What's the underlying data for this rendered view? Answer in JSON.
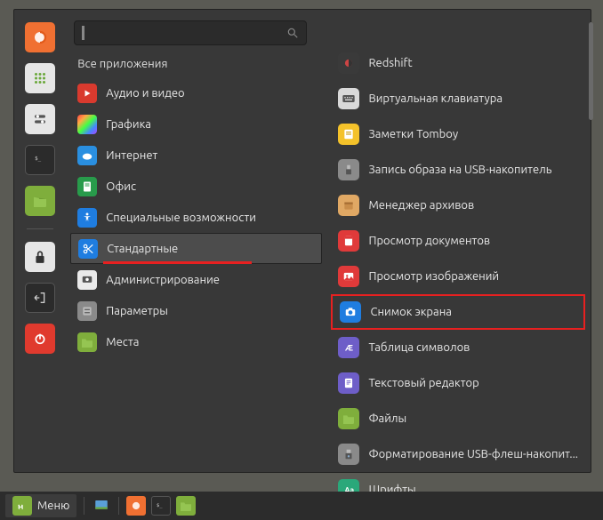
{
  "search": {
    "placeholder": ""
  },
  "all_apps_label": "Все приложения",
  "categories": [
    {
      "label": "Аудио и видео",
      "icon": "play-icon",
      "bg": "#d93a2e"
    },
    {
      "label": "Графика",
      "icon": "palette-icon",
      "bg": "linear"
    },
    {
      "label": "Интернет",
      "icon": "cloud-icon",
      "bg": "#2a8fe0"
    },
    {
      "label": "Офис",
      "icon": "office-icon",
      "bg": "#289b4b"
    },
    {
      "label": "Специальные возможности",
      "icon": "accessibility-icon",
      "bg": "#1f7de0"
    },
    {
      "label": "Стандартные",
      "icon": "scissors-icon",
      "bg": "#1f7de0",
      "selected": true,
      "underline": true
    },
    {
      "label": "Администрирование",
      "icon": "admin-icon",
      "bg": "#eaeaea"
    },
    {
      "label": "Параметры",
      "icon": "settings-icon",
      "bg": "#8a8a8a"
    },
    {
      "label": "Места",
      "icon": "folder-icon",
      "bg": "#7fae3c"
    }
  ],
  "apps": [
    {
      "label": "Redshift",
      "icon": "redshift-icon",
      "bg": "#3a3a3a"
    },
    {
      "label": "Виртуальная клавиатура",
      "icon": "keyboard-icon",
      "bg": "#d9d9d9"
    },
    {
      "label": "Заметки Tomboy",
      "icon": "note-icon",
      "bg": "#f4c22a"
    },
    {
      "label": "Запись образа на USB-накопитель",
      "icon": "usb-icon",
      "bg": "#8a8a8a"
    },
    {
      "label": "Менеджер архивов",
      "icon": "archive-icon",
      "bg": "#e0a864"
    },
    {
      "label": "Просмотр документов",
      "icon": "docview-icon",
      "bg": "#e03a3a"
    },
    {
      "label": "Просмотр изображений",
      "icon": "imageview-icon",
      "bg": "#e03a3a"
    },
    {
      "label": "Снимок экрана",
      "icon": "screenshot-icon",
      "bg": "#1f7de0",
      "boxed": true
    },
    {
      "label": "Таблица символов",
      "icon": "charmap-icon",
      "bg": "#6e5ec8"
    },
    {
      "label": "Текстовый редактор",
      "icon": "editor-icon",
      "bg": "#6e5ec8"
    },
    {
      "label": "Файлы",
      "icon": "files-icon",
      "bg": "#7fae3c"
    },
    {
      "label": "Форматирование USB-флеш-накопит...",
      "icon": "format-icon",
      "bg": "#8a8a8a"
    },
    {
      "label": "Шрифты",
      "icon": "fonts-icon",
      "bg": "#2aa87a"
    }
  ],
  "taskbar": {
    "menu_label": "Меню"
  }
}
